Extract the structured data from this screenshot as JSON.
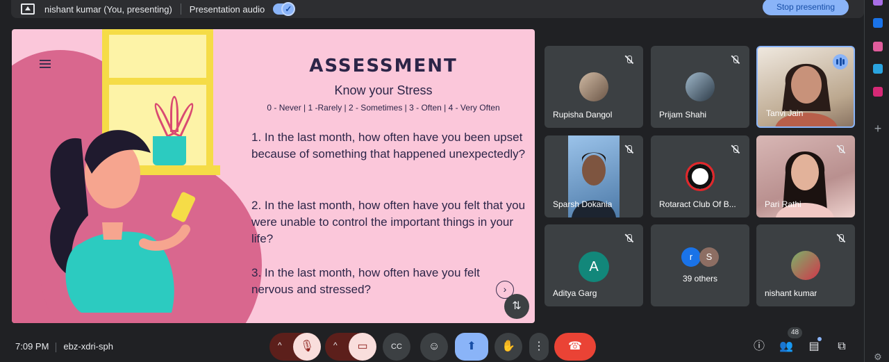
{
  "presenting_bar": {
    "presenter": "nishant kumar (You, presenting)",
    "audio_label": "Presentation audio",
    "stop_label": "Stop presenting"
  },
  "slide": {
    "title": "ASSESSMENT",
    "subtitle": "Know your Stress",
    "scale": "0 - Never | 1 -Rarely | 2 - Sometimes | 3 - Often | 4 - Very Often",
    "questions": [
      "1. In the last month, how often have you been upset because of something that happened unexpectedly?",
      "2. In the last month, how often have you felt that you were unable to control the important things in your life?",
      "3. In the last month, how often have you felt nervous and stressed?"
    ]
  },
  "participants": [
    {
      "name": "Rupisha Dangol",
      "muted": true
    },
    {
      "name": "Prijam Shahi",
      "muted": true
    },
    {
      "name": "Tanvi Jain",
      "speaking": true
    },
    {
      "name": "Sparsh Dokania",
      "muted": true
    },
    {
      "name": "Rotaract Club Of B...",
      "muted": true
    },
    {
      "name": "Pari Rathi",
      "muted": true
    },
    {
      "name": "Aditya Garg",
      "muted": true,
      "initial": "A"
    },
    {
      "name": "39 others",
      "initials": [
        "r",
        "S"
      ]
    },
    {
      "name": "nishant kumar",
      "muted": true
    }
  ],
  "meeting": {
    "time": "7:09 PM",
    "code": "ebz-xdri-sph",
    "people_count": "48"
  },
  "colors": {
    "background": "#202124",
    "accent": "#8ab4f8",
    "end_call": "#ea4335",
    "slide_bg": "#fbc7da"
  }
}
